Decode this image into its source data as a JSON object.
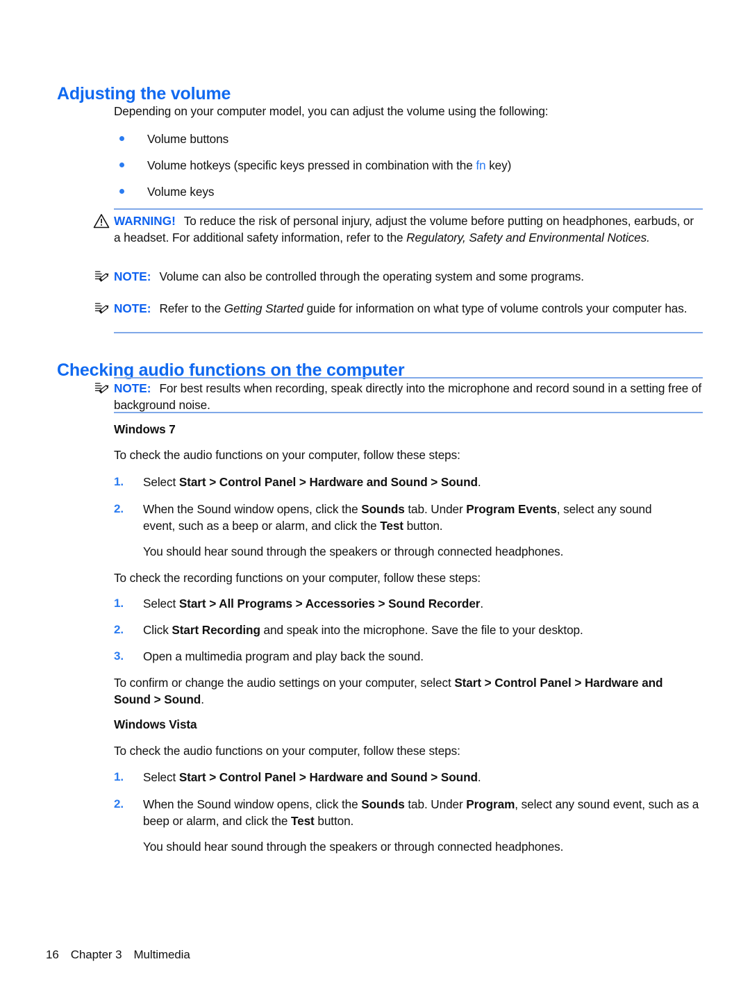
{
  "document": {
    "section1": {
      "heading": "Adjusting the volume",
      "intro": "Depending on your computer model, you can adjust the volume using the following:",
      "bullets": [
        {
          "text_before": "Volume buttons",
          "highlight": "",
          "text_after": ""
        },
        {
          "text_before": "Volume hotkeys (specific keys pressed in combination with the ",
          "highlight": "fn",
          "text_after": " key)"
        },
        {
          "text_before": "Volume keys",
          "highlight": "",
          "text_after": ""
        }
      ],
      "warning": {
        "icon": "warning-triangle-icon",
        "label": "WARNING!",
        "line1": "To reduce the risk of personal injury, adjust the volume before putting on headphones,",
        "line2_a": "earbuds, or a headset. For additional safety information, refer to the ",
        "line2_italic": "Regulatory, Safety and",
        "line3_italic": "Environmental Notices."
      },
      "note1": {
        "icon": "note-pencil-icon",
        "label": "NOTE:",
        "text": "Volume can also be controlled through the operating system and some programs."
      },
      "note2": {
        "icon": "note-pencil-icon",
        "label": "NOTE:",
        "line1_a": "Refer to the ",
        "line1_italic": "Getting Started",
        "line1_b": " guide for information on what type of volume controls your",
        "line2": "computer has."
      }
    },
    "section2": {
      "heading": "Checking audio functions on the computer",
      "note": {
        "icon": "note-pencil-icon",
        "label": "NOTE:",
        "line1": "For best results when recording, speak directly into the microphone and record sound in a",
        "line2": "setting free of background noise."
      },
      "win7": {
        "subheading": "Windows 7",
        "intro_audio": "To check the audio functions on your computer, follow these steps:",
        "steps_audio": [
          {
            "num": "1.",
            "parts": [
              {
                "t": "Select ",
                "b": false
              },
              {
                "t": "Start > Control Panel > Hardware and Sound > Sound",
                "b": true
              },
              {
                "t": ".",
                "b": false
              }
            ]
          },
          {
            "num": "2.",
            "parts": [
              {
                "t": "When the Sound window opens, click the ",
                "b": false
              },
              {
                "t": "Sounds",
                "b": true
              },
              {
                "t": " tab. Under ",
                "b": false
              },
              {
                "t": "Program Events",
                "b": true
              },
              {
                "t": ", select any sound event, such as a beep or alarm, and click the ",
                "b": false
              },
              {
                "t": "Test",
                "b": true
              },
              {
                "t": " button.",
                "b": false
              }
            ]
          }
        ],
        "result_audio": "You should hear sound through the speakers or through connected headphones.",
        "intro_recording": "To check the recording functions on your computer, follow these steps:",
        "steps_recording": [
          {
            "num": "1.",
            "parts": [
              {
                "t": "Select ",
                "b": false
              },
              {
                "t": "Start > All Programs > Accessories > Sound Recorder",
                "b": true
              },
              {
                "t": ".",
                "b": false
              }
            ]
          },
          {
            "num": "2.",
            "parts": [
              {
                "t": "Click ",
                "b": false
              },
              {
                "t": "Start Recording",
                "b": true
              },
              {
                "t": " and speak into the microphone. Save the file to your desktop.",
                "b": false
              }
            ]
          },
          {
            "num": "3.",
            "parts": [
              {
                "t": "Open a multimedia program and play back the sound.",
                "b": false
              }
            ]
          }
        ],
        "confirm_a": "To confirm or change the audio settings on your computer, select ",
        "confirm_bold1": "Start > Control Panel > Hardware",
        "confirm_bold2": "and Sound > Sound",
        "confirm_end": "."
      },
      "vista": {
        "subheading": "Windows Vista",
        "intro_audio": "To check the audio functions on your computer, follow these steps:",
        "steps_audio": [
          {
            "num": "1.",
            "parts": [
              {
                "t": "Select ",
                "b": false
              },
              {
                "t": "Start > Control Panel > Hardware and Sound > Sound",
                "b": true
              },
              {
                "t": ".",
                "b": false
              }
            ]
          },
          {
            "num": "2.",
            "parts": [
              {
                "t": "When the Sound window opens, click the ",
                "b": false
              },
              {
                "t": "Sounds",
                "b": true
              },
              {
                "t": " tab. Under ",
                "b": false
              },
              {
                "t": "Program",
                "b": true
              },
              {
                "t": ", select any sound event, such as a beep or alarm, and click the ",
                "b": false
              },
              {
                "t": "Test",
                "b": true
              },
              {
                "t": " button.",
                "b": false
              }
            ]
          }
        ],
        "result_audio": "You should hear sound through the speakers or through connected headphones."
      }
    },
    "footer": {
      "page_number": "16",
      "chapter": "Chapter 3",
      "chapter_title": "Multimedia"
    },
    "colors": {
      "heading_blue": "#1069f0",
      "accent_blue": "#2a7bf0",
      "rule_blue": "#7fa8e8",
      "text_black": "#111111"
    }
  }
}
